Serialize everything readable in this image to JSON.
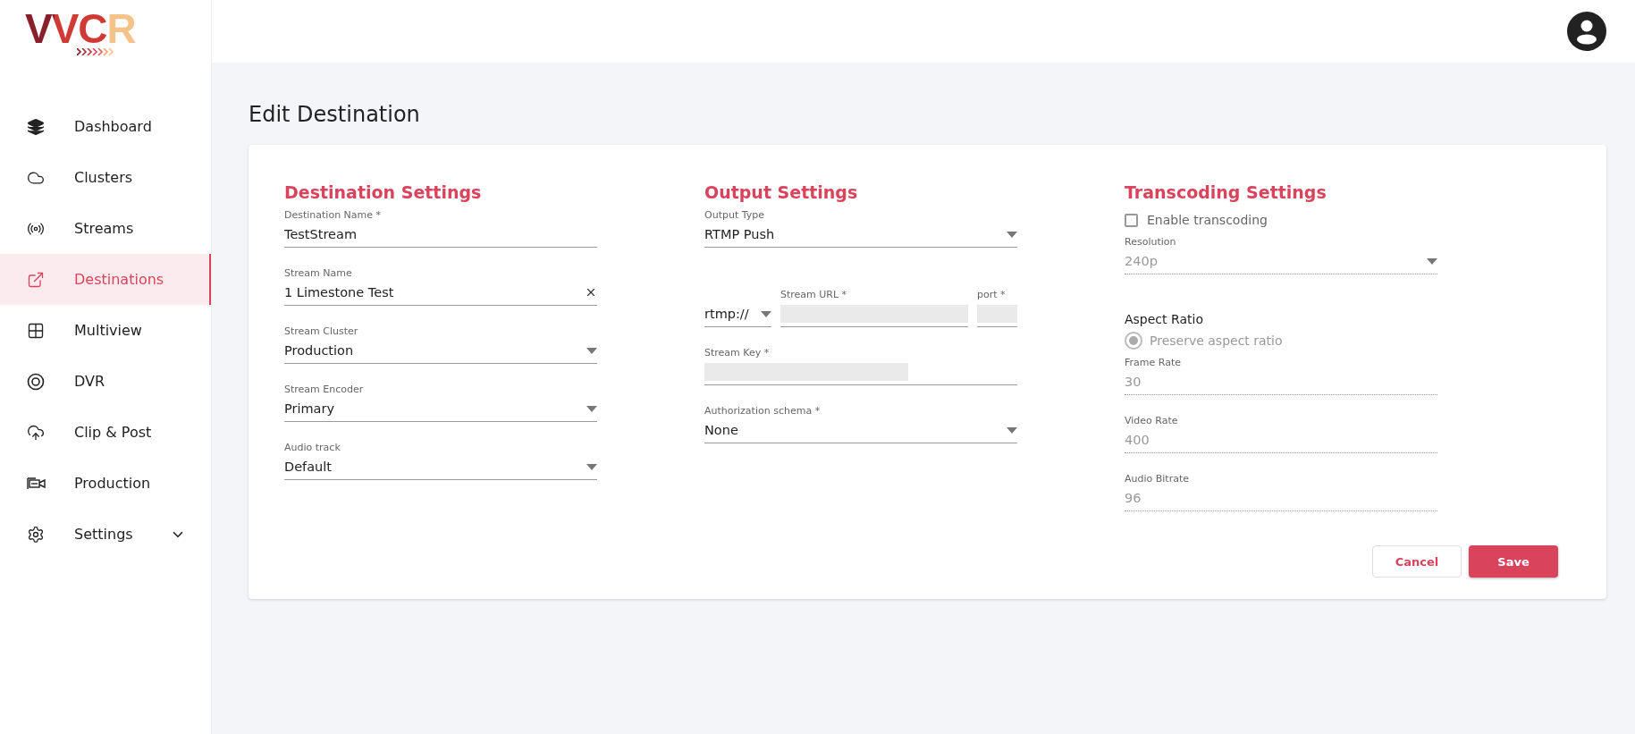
{
  "logo": {
    "text": "VVCR"
  },
  "sidebar": {
    "items": [
      {
        "label": "Dashboard",
        "selected": false
      },
      {
        "label": "Clusters",
        "selected": false
      },
      {
        "label": "Streams",
        "selected": false
      },
      {
        "label": "Destinations",
        "selected": true
      },
      {
        "label": "Multiview",
        "selected": false
      },
      {
        "label": "DVR",
        "selected": false
      },
      {
        "label": "Clip & Post",
        "selected": false
      },
      {
        "label": "Production",
        "selected": false
      },
      {
        "label": "Settings",
        "selected": false,
        "expanded": false
      }
    ]
  },
  "page": {
    "title": "Edit Destination"
  },
  "destination_settings": {
    "heading": "Destination Settings",
    "fields": [
      {
        "kind": "text",
        "label": "Destination Name *",
        "value": "TestStream"
      },
      {
        "kind": "clearable",
        "label": "Stream Name",
        "value": "1 Limestone Test"
      },
      {
        "kind": "select",
        "label": "Stream Cluster",
        "value": "Production"
      },
      {
        "kind": "select",
        "label": "Stream Encoder",
        "value": "Primary"
      },
      {
        "kind": "select",
        "label": "Audio track",
        "value": "Default"
      }
    ]
  },
  "output_settings": {
    "heading": "Output Settings",
    "output_type": {
      "label": "Output Type",
      "value": "RTMP Push"
    },
    "protocol": {
      "value": "rtmp://"
    },
    "stream_url": {
      "label": "Stream URL *"
    },
    "port": {
      "label": "port *"
    },
    "stream_key": {
      "label": "Stream Key *"
    },
    "authorization": {
      "label": "Authorization schema *",
      "value": "None"
    }
  },
  "transcoding_settings": {
    "heading": "Transcoding Settings",
    "enable": {
      "label": "Enable transcoding",
      "checked": false
    },
    "resolution": {
      "kind": "select",
      "label": "Resolution",
      "value": "240p",
      "disabled": true
    },
    "aspect_ratio": {
      "heading": "Aspect Ratio",
      "option": {
        "label": "Preserve aspect ratio",
        "selected": true,
        "disabled": true
      }
    },
    "fields": [
      {
        "kind": "text",
        "label": "Frame Rate",
        "value": "30",
        "disabled": true
      },
      {
        "kind": "text",
        "label": "Video Rate",
        "value": "400",
        "disabled": true
      },
      {
        "kind": "text",
        "label": "Audio Bitrate",
        "value": "96",
        "disabled": true
      }
    ]
  },
  "buttons": {
    "cancel": "Cancel",
    "save": "Save"
  }
}
